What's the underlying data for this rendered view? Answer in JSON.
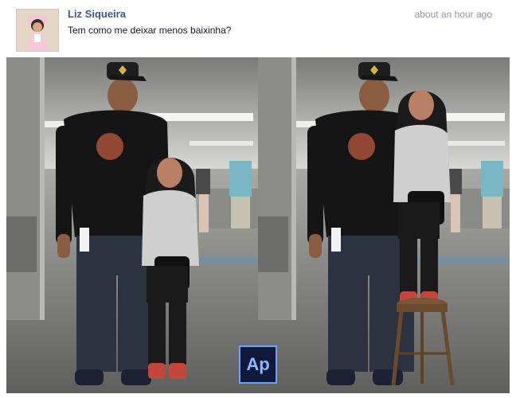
{
  "post": {
    "author": "Liz Siqueira",
    "timestamp": "about an hour ago",
    "message": "Tem como me deixar menos baixinha?"
  },
  "badge": {
    "label": "Ap"
  },
  "colors": {
    "link": "#3b5998",
    "meta": "#9197a3",
    "text": "#141823"
  }
}
